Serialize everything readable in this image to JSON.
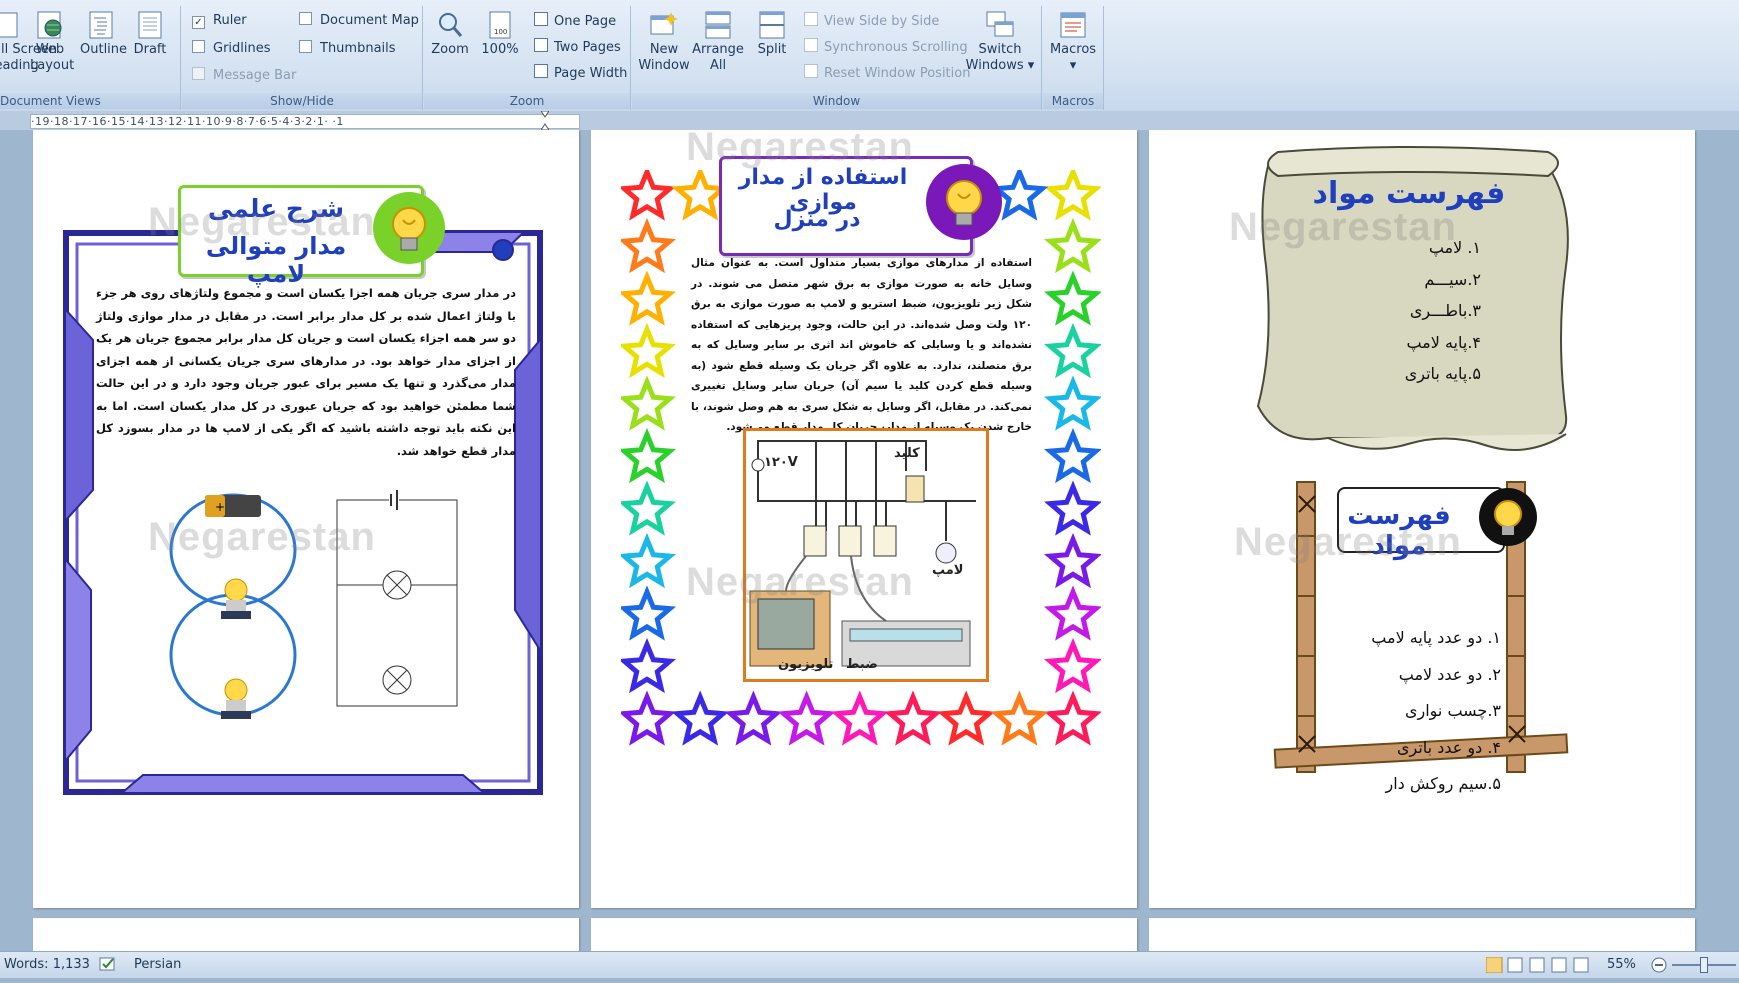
{
  "ribbon": {
    "document_views": {
      "label": "Document Views",
      "items": [
        "Full Screen\nReading",
        "Web\nLayout",
        "Outline",
        "Draft"
      ]
    },
    "show_hide": {
      "label": "Show/Hide",
      "ruler": "Ruler",
      "gridlines": "Gridlines",
      "message_bar": "Message Bar",
      "document_map": "Document Map",
      "thumbnails": "Thumbnails"
    },
    "zoom": {
      "label": "Zoom",
      "zoom_btn": "Zoom",
      "pct_btn": "100%",
      "one_page": "One Page",
      "two_pages": "Two Pages",
      "page_width": "Page Width"
    },
    "window": {
      "label": "Window",
      "new_window": "New\nWindow",
      "arrange_all": "Arrange\nAll",
      "split": "Split",
      "view_side_by_side": "View Side by Side",
      "sync_scrolling": "Synchronous Scrolling",
      "reset_position": "Reset Window Position",
      "switch_windows": "Switch\nWindows ▾"
    },
    "macros": {
      "label": "Macros",
      "btn": "Macros\n▾"
    }
  },
  "ruler_text": "·19·18·17·16·15·14·13·12·11·10·9·8·7·6·5·4·3·2·1·  ·1",
  "page1": {
    "title_line1": "شرح علمی",
    "title_line2": "مدار متوالی لامپ",
    "body": "در مدار سری جریان همه  اجزا یکسان است و مجموع ولتاژهای روی هر جزء با ولتاژ اعمال شده بر کل مدار برابر است. در مقابل در مدار موازی ولتاژ دو سر همه  اجزاء یکسان است و جریان کل مدار برابر مجموع جریان هر یک از اجزای مدار خواهد بود. در مدارهای سری جریان یکسانی از همه  اجزای مدار می‌گذرد و تنها یک مسیر برای عبور جریان وجود دارد و در این حالت شما مطمئن خواهید بود که جریان عبوری در کل مدار یکسان است. اما به این نکته باید توجه داشته باشید که اگر یکی از لامپ ها در مدار بسوزد کل مدار قطع خواهد شد."
  },
  "page2": {
    "title_line1": "استفاده از مدار موازی",
    "title_line2": "در منزل",
    "body": "استفاده از مدارهای موازی بسیار متداول است. به عنوان مثال وسایل خانه به صورت موازی به برق شهر متصل می شوند. در شکل زیر تلویزیون، ضبط استریو و لامپ به صورت موازی به برق ۱۲۰ ولت وصل شده‌اند. در این حالت، وجود پریزهایی که استفاده نشده‌اند و یا وسایلی که خاموش اند اثری بر سایر وسایل که به برق متصلند، ندارد. به علاوه اگر جریان یک وسیله قطع شود (به وسیله قطع کردن کلید یا سیم آن) جریان سایر وسایل تغییری نمی‌کند. در مقابل، اگر وسایل به شکل سری به هم وصل شوند، با خارج شدن یک وسیله از مدار، جریان کل مدار قطع می‌شود.",
    "fig_voltage": "۱۲۰V",
    "fig_switch": "کلید",
    "fig_lamp": "لامپ",
    "fig_tv": "تلویزیون",
    "fig_recorder": "ضبط"
  },
  "page3": {
    "list1_title": "فهرست مواد",
    "list1": [
      "۱. لامپ",
      "۲.سیـــم",
      "۳.باطـــری",
      "۴.پایه لامپ",
      "۵.پایه باتری"
    ],
    "list2_title": "فهرست مواد",
    "list2": [
      "۱. دو عدد پایه لامپ",
      "۲. دو عدد لامپ",
      "۳.چسب نواری",
      "۴. دو عدد باتری",
      "۵.سیم روکش دار"
    ]
  },
  "watermark": "Negarestan",
  "status": {
    "words": "Words: 1,133",
    "language": "Persian",
    "zoom_pct": "55%"
  }
}
